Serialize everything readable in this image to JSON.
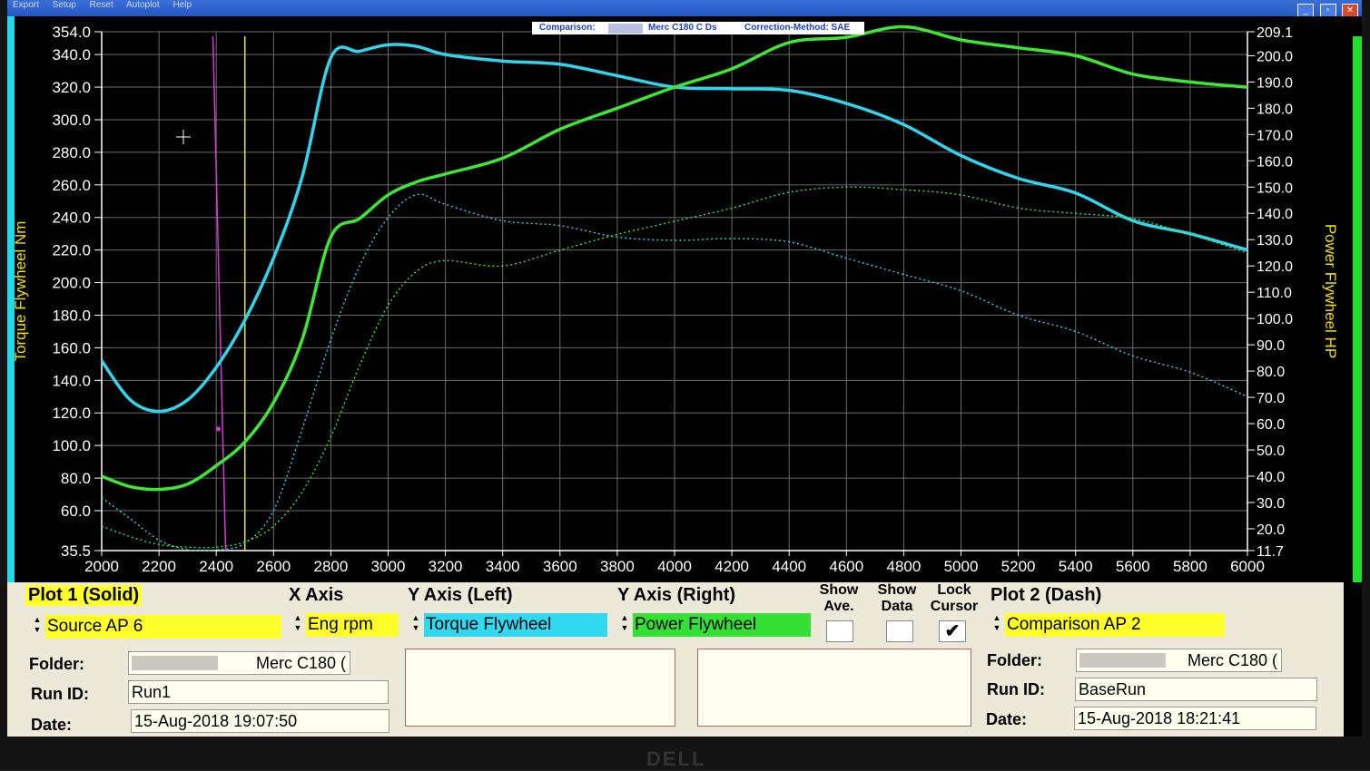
{
  "window": {
    "menu": [
      "Export",
      "Setup",
      "Reset",
      "Autoplot",
      "Help"
    ],
    "buttons": [
      "_",
      "▫",
      "✕"
    ]
  },
  "chart_header": {
    "comparison_label": "Comparison:",
    "comparison_value": "Merc C180 C Ds",
    "correction_label": "Correction-Method: SAE"
  },
  "colors": {
    "torque": "#2fd5ec",
    "power": "#3ce834",
    "magenta_cursor": "#e030e0",
    "yellow_cursor": "#e8e800",
    "grid": "#6b6b6b",
    "background": "#000000"
  },
  "chart_data": {
    "type": "line",
    "xlabel": "",
    "ylabel": "Torque Flywheel Nm",
    "y2label": "Power Flywheel HP",
    "xlim": [
      2000,
      6000
    ],
    "ylim": [
      35.5,
      354.0
    ],
    "y2lim": [
      11.7,
      209.1
    ],
    "x_ticks": [
      "2000",
      "2200",
      "2400",
      "2600",
      "2800",
      "3000",
      "3200",
      "3400",
      "3600",
      "3800",
      "4000",
      "4200",
      "4400",
      "4600",
      "4800",
      "5000",
      "5200",
      "5400",
      "5600",
      "5800",
      "6000"
    ],
    "y_ticks": [
      "354.0",
      "340.0",
      "320.0",
      "300.0",
      "280.0",
      "260.0",
      "240.0",
      "220.0",
      "200.0",
      "180.0",
      "160.0",
      "140.0",
      "120.0",
      "100.0",
      "80.0",
      "60.0",
      "35.5"
    ],
    "y2_ticks": [
      "209.1",
      "200.0",
      "190.0",
      "180.0",
      "170.0",
      "160.0",
      "150.0",
      "140.0",
      "130.0",
      "120.0",
      "110.0",
      "100.0",
      "90.0",
      "80.0",
      "70.0",
      "60.0",
      "50.0",
      "40.0",
      "30.0",
      "20.0",
      "11.7"
    ],
    "grid": true,
    "cursors": [
      {
        "name": "magenta",
        "x": 2420
      },
      {
        "name": "yellow",
        "x": 2500
      }
    ],
    "series": [
      {
        "key": "torque_solid",
        "axis": "left",
        "style": "solid",
        "color": "#2fd5ec",
        "x": [
          2000,
          2100,
          2200,
          2300,
          2400,
          2500,
          2600,
          2700,
          2800,
          2900,
          3000,
          3100,
          3200,
          3400,
          3600,
          3800,
          4000,
          4200,
          4400,
          4600,
          4800,
          5000,
          5200,
          5400,
          5600,
          5800,
          6000
        ],
        "y": [
          152,
          128,
          121,
          128,
          148,
          177,
          215,
          265,
          338,
          342,
          346,
          345,
          340,
          336,
          334,
          327,
          320,
          319,
          318,
          310,
          297,
          278,
          264,
          255,
          238,
          230,
          220
        ]
      },
      {
        "key": "power_solid",
        "axis": "right",
        "style": "solid",
        "color": "#3ce834",
        "x": [
          2000,
          2100,
          2200,
          2300,
          2400,
          2500,
          2600,
          2700,
          2800,
          2900,
          3000,
          3100,
          3200,
          3400,
          3600,
          3800,
          4000,
          4200,
          4400,
          4600,
          4800,
          5000,
          5200,
          5400,
          5600,
          5800,
          6000
        ],
        "y": [
          40,
          36,
          35,
          37,
          44,
          53,
          68,
          92,
          131,
          138,
          147,
          152,
          155,
          161,
          172,
          180,
          188,
          195,
          205,
          207,
          211,
          206,
          203,
          200,
          193,
          190,
          188
        ]
      },
      {
        "key": "torque_dash",
        "axis": "left",
        "style": "dash",
        "color": "#2fd5ec",
        "x": [
          2000,
          2100,
          2200,
          2300,
          2400,
          2500,
          2600,
          2700,
          2800,
          2900,
          3000,
          3100,
          3200,
          3400,
          3600,
          3800,
          4000,
          4200,
          4400,
          4600,
          4800,
          5000,
          5200,
          5400,
          5600,
          5800,
          6000
        ],
        "y": [
          68,
          55,
          42,
          36,
          36,
          40,
          60,
          110,
          165,
          210,
          240,
          254,
          248,
          238,
          235,
          228,
          226,
          227,
          225,
          215,
          205,
          195,
          180,
          170,
          155,
          145,
          130
        ]
      },
      {
        "key": "power_dash",
        "axis": "right",
        "style": "dash",
        "color": "#3ce834",
        "x": [
          2000,
          2100,
          2200,
          2300,
          2400,
          2500,
          2600,
          2700,
          2800,
          2900,
          3000,
          3100,
          3200,
          3400,
          3600,
          3800,
          4000,
          4200,
          4400,
          4600,
          4800,
          5000,
          5200,
          5400,
          5600,
          5800,
          6000
        ],
        "y": [
          21,
          17,
          14,
          13,
          13,
          15,
          21,
          34,
          55,
          82,
          105,
          118,
          122,
          120,
          126,
          132,
          137,
          142,
          148,
          150,
          149,
          147,
          142,
          140,
          138,
          132,
          125
        ]
      }
    ]
  },
  "panel": {
    "plot1_header": "Plot 1 (Solid)",
    "x_axis_header": "X Axis",
    "y_left_header": "Y Axis (Left)",
    "y_right_header": "Y Axis (Right)",
    "plot2_header": "Plot 2 (Dash)",
    "plot1_select": "Source AP 6",
    "x_axis_select": "Eng rpm",
    "y_left_select": "Torque Flywheel",
    "y_right_select": "Power Flywheel",
    "plot2_select": "Comparison AP 2",
    "show_ave_label_1": "Show",
    "show_ave_label_2": "Ave.",
    "show_data_label_1": "Show",
    "show_data_label_2": "Data",
    "lock_cursor_label_1": "Lock",
    "lock_cursor_label_2": "Cursor",
    "lock_cursor_check": "✔",
    "folder_label": "Folder:",
    "run_id_label": "Run ID:",
    "date_label": "Date:",
    "plot1_folder": "Merc C180 (",
    "plot1_run_id": "Run1",
    "plot1_date": "15-Aug-2018  19:07:50",
    "plot2_folder": "Merc C180 (",
    "plot2_run_id": "BaseRun",
    "plot2_date": "15-Aug-2018  18:21:41"
  },
  "bezel": {
    "brand": "DELL"
  }
}
